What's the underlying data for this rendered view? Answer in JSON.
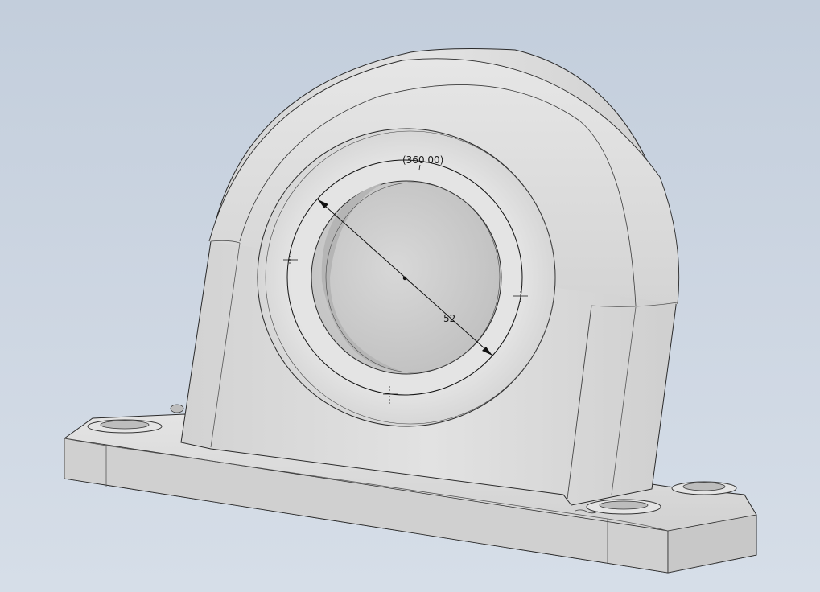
{
  "viewport": {
    "background_top": "#c3cedc",
    "background_bottom": "#d6dee8"
  },
  "model": {
    "part": "pillow-block-bearing-housing",
    "body_color": "#dcdcdc",
    "edge_color": "#2a2a2a"
  },
  "sketch": {
    "angle_dimension": "(360.00)",
    "diameter_dimension": "52"
  }
}
